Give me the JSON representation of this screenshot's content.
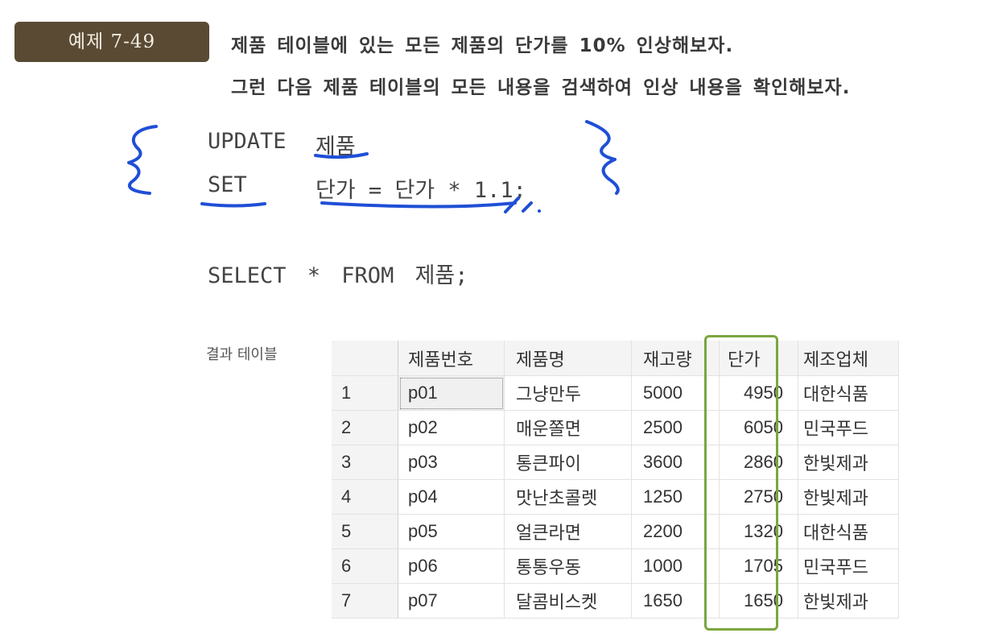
{
  "example": {
    "badge": "예제 7-49",
    "line1": "제품 테이블에 있는 모든 제품의 단가를 10% 인상해보자.",
    "line2": "그런 다음 제품 테이블의 모든 내용을 검색하여 인상 내용을 확인해보자."
  },
  "code": {
    "update_kw": "UPDATE",
    "update_target": "제품",
    "set_kw": "SET",
    "set_expr": "단가 = 단가 * 1.1;",
    "select_stmt": "SELECT * FROM 제품;"
  },
  "result": {
    "label": "결과 테이블",
    "headers": [
      "",
      "제품번호",
      "제품명",
      "재고량",
      "단가",
      "제조업체"
    ],
    "rows": [
      [
        "1",
        "p01",
        "그냥만두",
        "5000",
        "4950",
        "대한식품"
      ],
      [
        "2",
        "p02",
        "매운쫄면",
        "2500",
        "6050",
        "민국푸드"
      ],
      [
        "3",
        "p03",
        "통큰파이",
        "3600",
        "2860",
        "한빛제과"
      ],
      [
        "4",
        "p04",
        "맛난초콜렛",
        "1250",
        "2750",
        "한빛제과"
      ],
      [
        "5",
        "p05",
        "얼큰라면",
        "2200",
        "1320",
        "대한식품"
      ],
      [
        "6",
        "p06",
        "통통우동",
        "1000",
        "1705",
        "민국푸드"
      ],
      [
        "7",
        "p07",
        "달콤비스켓",
        "1650",
        "1650",
        "한빛제과"
      ]
    ]
  },
  "colors": {
    "badge_bg": "#5a4a34",
    "ink_blue": "#1f4fd6",
    "highlight_green": "#7ba63f"
  }
}
